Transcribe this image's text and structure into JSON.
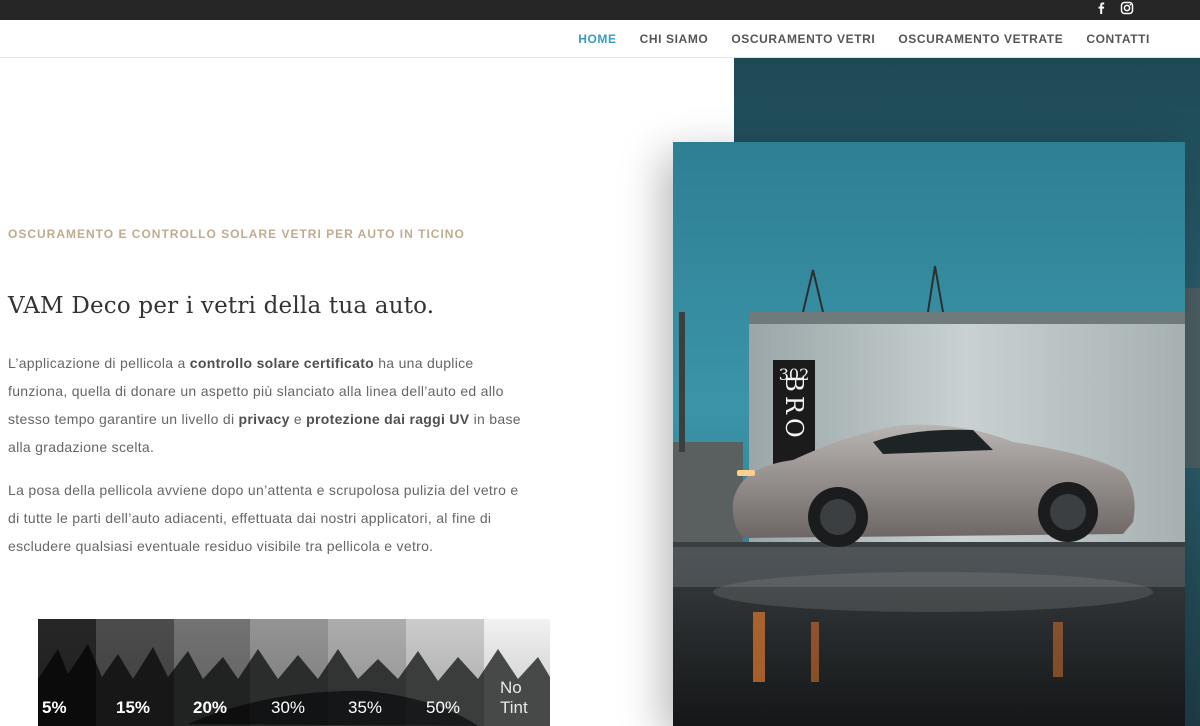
{
  "social": {
    "facebook_icon": "facebook-icon",
    "instagram_icon": "instagram-icon"
  },
  "nav": {
    "items": [
      {
        "label": "HOME",
        "active": true
      },
      {
        "label": "CHI SIAMO",
        "active": false
      },
      {
        "label": "OSCURAMENTO VETRI",
        "active": false
      },
      {
        "label": "OSCURAMENTO VETRATE",
        "active": false
      },
      {
        "label": "CONTATTI",
        "active": false
      }
    ]
  },
  "hero": {
    "kicker": "OSCURAMENTO E CONTROLLO SOLARE VETRI PER AUTO IN TICINO",
    "title": "VAM Deco per i vetri della tua auto.",
    "p1": {
      "t1": "L’applicazione di pellicola a ",
      "b1": "controllo solare certificato",
      "t2": " ha una duplice funziona, quella di donare un aspetto più slanciato alla linea dell’auto ed allo stesso tempo garantire un livello di ",
      "b2": "privacy",
      "t3": " e ",
      "b3": "protezione dai raggi UV",
      "t4": " in base alla gradazione scelta."
    },
    "p2": "La posa della pellicola avviene dopo un’attenta e scrupolosa pulizia del vetro e di tutte le parti dell’auto adiacenti, effettuata dai nostri applicatori, al fine di escludere qualsiasi eventuale residuo visibile tra pellicola e vetro."
  },
  "tint_image": {
    "labels": [
      "5%",
      "15%",
      "20%",
      "30%",
      "35%",
      "50%",
      "No Tint"
    ]
  },
  "photo": {
    "sign_number": "302",
    "sign_letters": "BRO"
  },
  "colors": {
    "accent": "#3a9bbf",
    "kicker": "#c0ab8e",
    "topbar": "#262626"
  }
}
